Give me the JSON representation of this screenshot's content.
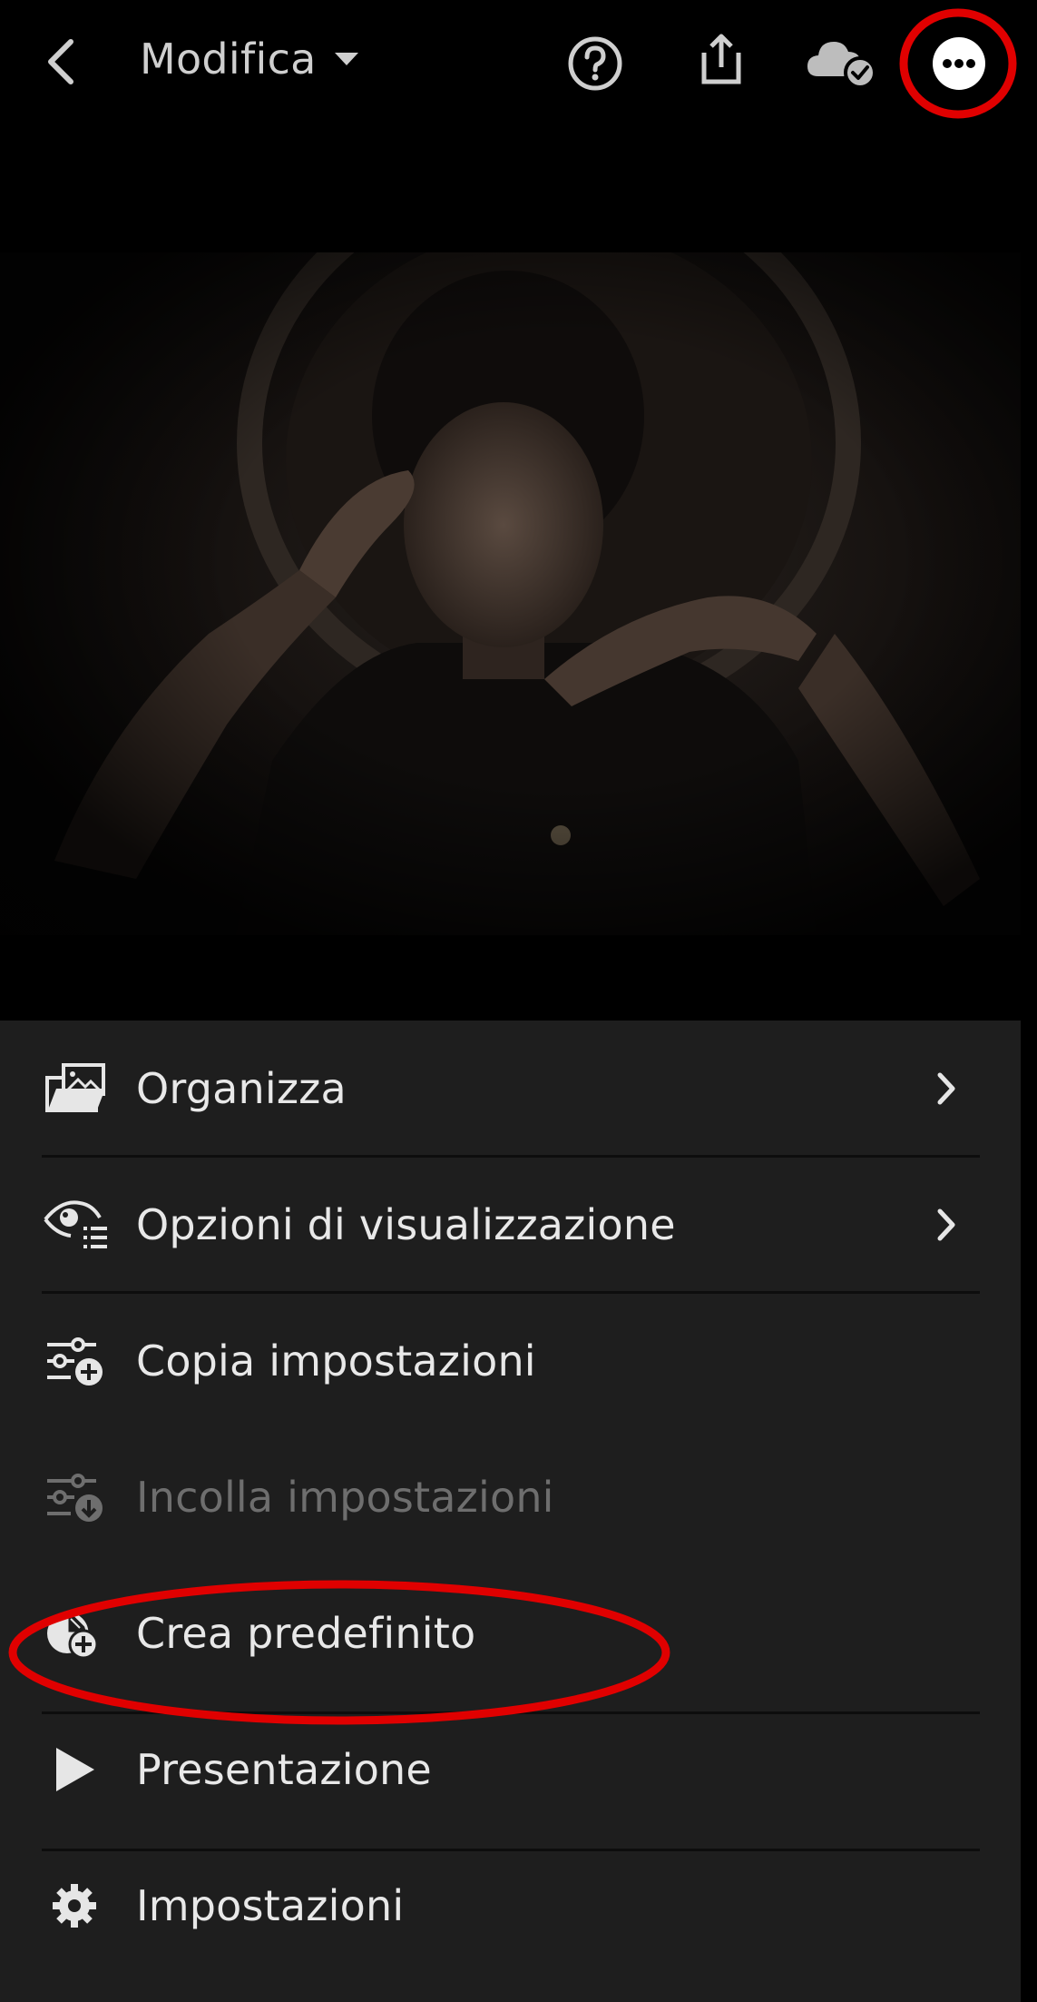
{
  "header": {
    "title": "Modifica",
    "icons": {
      "back": "chevron-left-icon",
      "dropdown": "caret-down-icon",
      "help": "help-circle-icon",
      "share": "share-icon",
      "cloud": "cloud-check-icon",
      "more": "more-dots-icon"
    }
  },
  "menu": {
    "items": [
      {
        "label": "Organizza",
        "icon": "organize-photos-icon",
        "has_submenu": true,
        "enabled": true
      },
      {
        "label": "Opzioni di visualizzazione",
        "icon": "view-options-eye-icon",
        "has_submenu": true,
        "enabled": true
      },
      {
        "label": "Copia impostazioni",
        "icon": "copy-settings-icon",
        "has_submenu": false,
        "enabled": true
      },
      {
        "label": "Incolla impostazioni",
        "icon": "paste-settings-icon",
        "has_submenu": false,
        "enabled": false
      },
      {
        "label": "Crea predefinito",
        "icon": "create-preset-icon",
        "has_submenu": false,
        "enabled": true
      },
      {
        "label": "Presentazione",
        "icon": "play-icon",
        "has_submenu": false,
        "enabled": true
      },
      {
        "label": "Impostazioni",
        "icon": "gear-icon",
        "has_submenu": false,
        "enabled": true
      }
    ]
  },
  "colors": {
    "background": "#000000",
    "sheet": "#1e1e1e",
    "text": "#e8e8e8",
    "disabled_text": "#6e6e6e",
    "annotation": "#e00000"
  }
}
